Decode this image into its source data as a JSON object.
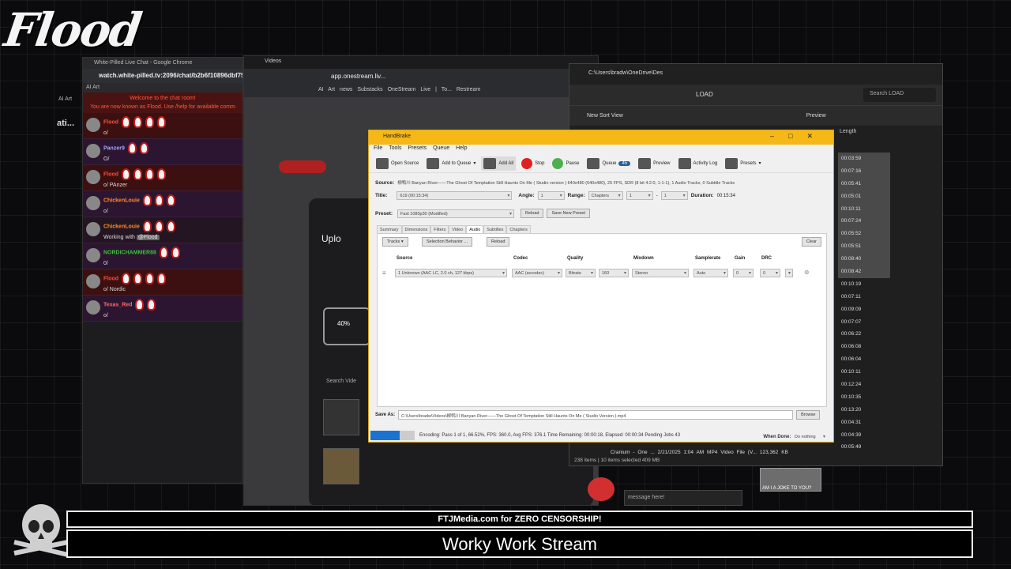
{
  "logo": "Flood",
  "side": {
    "ai_label": "AI Art",
    "tab_text": "ati..."
  },
  "chat": {
    "title": "White-Pilled Live Chat - Google Chrome",
    "url": "watch.white-pilled.tv:2096/chat/b2b6f10896dbf75",
    "bookmark": "AI Art",
    "system_lines": [
      "Welcome to the chat room!",
      "You are now known as Flood. Use /help for available comm"
    ],
    "messages": [
      {
        "name": "Flood",
        "text": "o/",
        "style": "red",
        "name_color": "#ff4a3a",
        "badges": 4
      },
      {
        "name": "Panzer9",
        "text": "O/",
        "style": "purple",
        "name_color": "#a0a8ff",
        "badges": 2
      },
      {
        "name": "Flood",
        "text": "o/ PAnzer",
        "style": "red",
        "name_color": "#ff4a3a",
        "badges": 4
      },
      {
        "name": "ChickenLouie",
        "text": "o/",
        "style": "purple",
        "name_color": "#ff8a2a",
        "badges": 3
      },
      {
        "name": "ChickenLouie",
        "text": "Working with ",
        "mention": "@Flood",
        "style": "dark",
        "name_color": "#ff8a2a",
        "badges": 3
      },
      {
        "name": "NORDICHAMMER88",
        "text": "0/",
        "style": "purple",
        "name_color": "#3ac03a",
        "badges": 2
      },
      {
        "name": "Flood",
        "text": "o/ Nordic",
        "style": "red",
        "name_color": "#ff4a3a",
        "badges": 4
      },
      {
        "name": "Texas_Red",
        "text": "o/",
        "style": "purple",
        "name_color": "#ff6a6a",
        "badges": 2
      }
    ]
  },
  "mid": {
    "tab": "Videos",
    "url": "app.onestream.liv...",
    "bookmarks": "AI Art  news  Substacks  OneStream Live | To...  Restream",
    "upload_title": "Uplo",
    "progress": "40%",
    "progress_value": 0.4,
    "search": "Search Vide"
  },
  "explorer": {
    "path_tab": "C:\\Users\\bradw\\OneDrive\\Des",
    "breadcrumb": "LOAD",
    "search": "Search LOAD",
    "toolbar": "New    Sort    View",
    "preview": "Preview",
    "length_head": "Length",
    "durations": [
      "00:03:59",
      "00:07:16",
      "00:05:41",
      "00:05:01",
      "00:10:11",
      "00:07:24",
      "00:05:52",
      "00:05:51",
      "00:08:40",
      "00:08:42",
      "00:10:19",
      "00:07:11",
      "00:09:09",
      "00:07:07",
      "00:06:22",
      "00:06:08",
      "00:06:04",
      "00:10:11",
      "00:12:24",
      "00:10:35",
      "00:13:20",
      "00:04:31",
      "00:04:39",
      "00:05:49"
    ],
    "highlighted": [
      0,
      1,
      2,
      3,
      4,
      5,
      6,
      7,
      8,
      9
    ],
    "file_row": "Cranium - One ...    2/21/2025 1:04 AM        MP4 Video File (V...        123,362 KB",
    "status": "238 items  |  10 items selected  409 MB"
  },
  "handbrake": {
    "title": "HandBrake",
    "menu": [
      "File",
      "Tools",
      "Presets",
      "Queue",
      "Help"
    ],
    "toolbar": {
      "open_source": "Open Source",
      "add_to_queue": "Add to Queue",
      "add_all": "Add All",
      "stop": "Stop",
      "pause": "Pause",
      "queue": "Queue",
      "queue_count": "45",
      "preview": "Preview",
      "activity_log": "Activity Log",
      "presets": "Presets"
    },
    "source_label": "Source:",
    "source_value": "柳鸭川 Banyan River——The Ghost Of Temptation Still Haunts On Me ( Studio version )   640x480 (640x480), 25 FPS, SDR (8 bit 4:2:0, 1-1-1), 1 Audio Tracks, 0 Subtitle Tracks",
    "title_label": "Title:",
    "title_value": "619 (00:15:34)",
    "angle_label": "Angle:",
    "angle_value": "1",
    "range_label": "Range:",
    "range_value": "Chapters",
    "range_from": "1",
    "range_to": "1",
    "duration_label": "Duration:",
    "duration_value": "00:15:34",
    "preset_label": "Preset:",
    "preset_value": "Fast 1080p30 (Modified)",
    "reload": "Reload",
    "save_new_preset": "Save New Preset",
    "tabs": [
      "Summary",
      "Dimensions",
      "Filters",
      "Video",
      "Audio",
      "Subtitles",
      "Chapters"
    ],
    "active_tab": "Audio",
    "tracks_btn": "Tracks",
    "selection_behavior": "Selection Behavior ...",
    "reload_btn": "Reload",
    "clear_btn": "Clear",
    "columns": [
      "Source",
      "Codec",
      "Quality",
      "Mixdown",
      "Samplerate",
      "Gain",
      "DRC"
    ],
    "track": {
      "source": "1 Unknown (AAC LC, 2.0 ch, 127 kbps)",
      "codec": "AAC (avcodec)",
      "quality_mode": "Bitrate",
      "bitrate": "160",
      "mixdown": "Stereo",
      "samplerate": "Auto",
      "gain": "0",
      "drc": "0"
    },
    "save_as_label": "Save As:",
    "save_as_value": "C:\\Users\\bradw\\Videos\\柳鸭川 Banyan River——The Ghost Of Temptation Still Haunts On Me ( Studio Version ).mp4",
    "browse": "Browse",
    "status": "Encoding: Pass 1 of 1,  66.52%,  FPS: 360.0,  Avg FPS: 376.1  Time Remaining: 00:00:18,  Elapsed: 00:00:34   Pending Jobs 43",
    "progress_value": 0.6652,
    "when_done_label": "When Done:",
    "when_done_value": "Do nothing"
  },
  "overlay": {
    "message_placeholder": "message here!",
    "joke_caption": "AM I A JOKE TO YOU?",
    "banner_top": "FTJMedia.com for ZERO CENSORSHIP!",
    "banner_main": "Worky Work Stream"
  }
}
